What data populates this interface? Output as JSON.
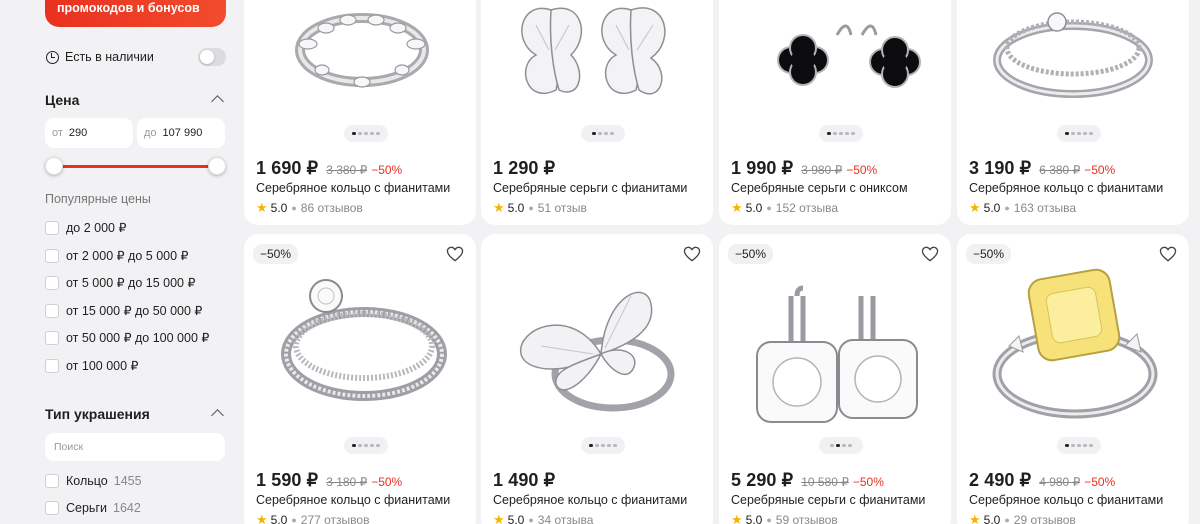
{
  "sidebar": {
    "promo_text": "промокодов и бонусов",
    "in_stock_label": "Есть в наличии",
    "price_title": "Цена",
    "price_from_prefix": "от",
    "price_from_value": "290",
    "price_to_prefix": "до",
    "price_to_value": "107 990",
    "popular_prices_title": "Популярные цены",
    "popular_prices": [
      "до 2 000 ₽",
      "от 2 000 ₽ до 5 000 ₽",
      "от 5 000 ₽ до 15 000 ₽",
      "от 15 000 ₽ до 50 000 ₽",
      "от 50 000 ₽ до 100 000 ₽",
      "от 100 000 ₽"
    ],
    "type_title": "Тип украшения",
    "type_search_placeholder": "Поиск",
    "types": [
      {
        "label": "Кольцо",
        "count": "1455"
      },
      {
        "label": "Серьги",
        "count": "1642"
      }
    ]
  },
  "products": [
    {
      "price": "1 690 ₽",
      "old_price": "3 380 ₽",
      "discount": "−50%",
      "name": "Серебряное кольцо с фианитами",
      "rating": "5.0",
      "reviews": "86 отзывов",
      "icon": "ring-icon"
    },
    {
      "price": "1 290 ₽",
      "old_price": "",
      "discount": "",
      "name": "Серебряные серьги с фианитами",
      "rating": "5.0",
      "reviews": "51 отзыв",
      "icon": "butterfly-earrings-icon"
    },
    {
      "price": "1 990 ₽",
      "old_price": "3 980 ₽",
      "discount": "−50%",
      "name": "Серебряные серьги с ониксом",
      "rating": "5.0",
      "reviews": "152 отзыва",
      "icon": "clover-earrings-icon"
    },
    {
      "price": "3 190 ₽",
      "old_price": "6 380 ₽",
      "discount": "−50%",
      "name": "Серебряное кольцо с фианитами",
      "rating": "5.0",
      "reviews": "163 отзыва",
      "icon": "ring-icon"
    },
    {
      "badge": "−50%",
      "price": "1 590 ₽",
      "old_price": "3 180 ₽",
      "discount": "−50%",
      "name": "Серебряное кольцо с фианитами",
      "rating": "5.0",
      "reviews": "277 отзывов",
      "icon": "solitaire-ring-icon"
    },
    {
      "badge": "",
      "price": "1 490 ₽",
      "old_price": "",
      "discount": "",
      "name": "Серебряное кольцо с фианитами",
      "rating": "5.0",
      "reviews": "34 отзыва",
      "icon": "butterfly-ring-icon"
    },
    {
      "badge": "−50%",
      "price": "5 290 ₽",
      "old_price": "10 580 ₽",
      "discount": "−50%",
      "name": "Серебряные серьги с фианитами",
      "rating": "5.0",
      "reviews": "59 отзывов",
      "icon": "halo-earrings-icon"
    },
    {
      "badge": "−50%",
      "price": "2 490 ₽",
      "old_price": "4 980 ₽",
      "discount": "−50%",
      "name": "Серебряное кольцо с фианитами",
      "rating": "5.0",
      "reviews": "29 отзывов",
      "icon": "yellow-stone-ring-icon"
    }
  ],
  "colors": {
    "accent": "#e8311f",
    "star": "#f5b400",
    "page_bg": "#f2f2f4"
  }
}
